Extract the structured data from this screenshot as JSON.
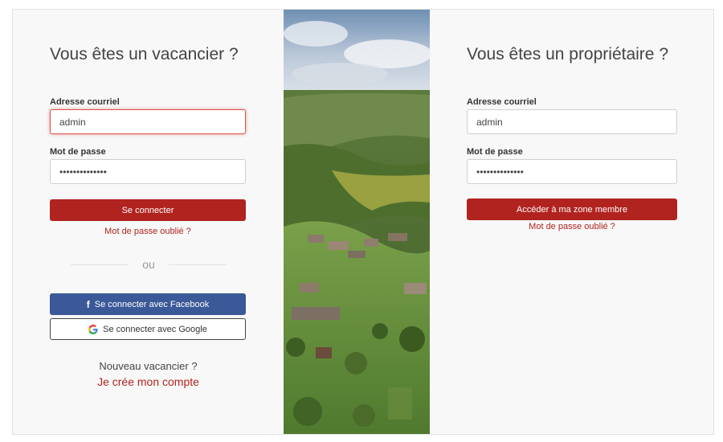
{
  "vacationer": {
    "title": "Vous êtes un vacancier ?",
    "email_label": "Adresse courriel",
    "email_value": "admin",
    "password_label": "Mot de passe",
    "password_value": "••••••••••••••",
    "login_button": "Se connecter",
    "forgot_link": "Mot de passe oublié ?",
    "or_text": "ou",
    "facebook_button": "Se connecter avec Facebook",
    "google_button": "Se connecter avec Google",
    "new_text": "Nouveau vacancier ?",
    "create_link": "Je crée mon compte"
  },
  "owner": {
    "title": "Vous êtes un propriétaire ?",
    "email_label": "Adresse courriel",
    "email_value": "admin",
    "password_label": "Mot de passe",
    "password_value": "••••••••••••••",
    "login_button": "Accéder à ma zone membre",
    "forgot_link": "Mot de passe oublié ?"
  },
  "colors": {
    "accent": "#b0231f",
    "facebook": "#3b5998"
  },
  "icons": {
    "facebook": "facebook-icon",
    "google": "google-icon"
  }
}
